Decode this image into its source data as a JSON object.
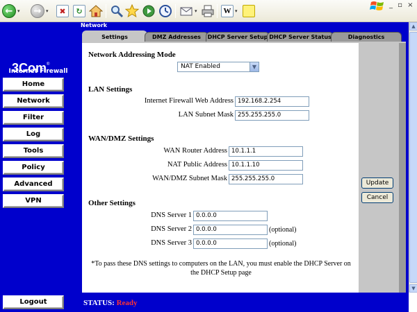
{
  "browser": {
    "window_controls": "_ ▫ ×",
    "toolbar_icons": [
      "back-icon",
      "forward-icon",
      "stop-icon",
      "refresh-icon",
      "home-icon",
      "search-icon",
      "favorites-icon",
      "history-icon",
      "mail-icon",
      "print-icon",
      "word-icon",
      "notes-icon"
    ]
  },
  "nav": {
    "product_name": "Internet Firewall",
    "items": [
      {
        "label": "Home"
      },
      {
        "label": "Network"
      },
      {
        "label": "Filter"
      },
      {
        "label": "Log"
      },
      {
        "label": "Tools"
      },
      {
        "label": "Policy"
      },
      {
        "label": "Advanced"
      },
      {
        "label": "VPN"
      }
    ],
    "logout_label": "Logout"
  },
  "frame": {
    "title": "Network",
    "tabs": [
      {
        "label": "Settings",
        "active": true
      },
      {
        "label": "DMZ Addresses",
        "active": false
      },
      {
        "label": "DHCP Server Setup",
        "active": false
      },
      {
        "label": "DHCP Server Status",
        "active": false
      },
      {
        "label": "Diagnostics",
        "active": false
      }
    ]
  },
  "form": {
    "addressing_mode": {
      "title": "Network Addressing Mode",
      "value": "NAT Enabled"
    },
    "lan": {
      "title": "LAN Settings",
      "web_address_label": "Internet Firewall Web Address",
      "web_address_value": "192.168.2.254",
      "subnet_label": "LAN Subnet Mask",
      "subnet_value": "255.255.255.0"
    },
    "wan": {
      "title": "WAN/DMZ Settings",
      "router_label": "WAN Router Address",
      "router_value": "10.1.1.1",
      "nat_label": "NAT Public Address",
      "nat_value": "10.1.1.10",
      "subnet_label": "WAN/DMZ Subnet Mask",
      "subnet_value": "255.255.255.0"
    },
    "other": {
      "title": "Other Settings",
      "dns1_label": "DNS Server 1",
      "dns1_value": "0.0.0.0",
      "dns2_label": "DNS Server 2",
      "dns2_value": "0.0.0.0",
      "dns3_label": "DNS Server 3",
      "dns3_value": "0.0.0.0",
      "optional_text": "(optional)"
    },
    "note": "*To pass these DNS settings to computers on the LAN, you must enable the DHCP Server on the DHCP Setup page"
  },
  "actions": {
    "update_label": "Update",
    "cancel_label": "Cancel"
  },
  "status": {
    "label": "STATUS: ",
    "value": "Ready",
    "value_color": "#ff3333"
  },
  "colors": {
    "brand_blue": "#0000cc",
    "panel_gray": "#c6c6c6"
  }
}
